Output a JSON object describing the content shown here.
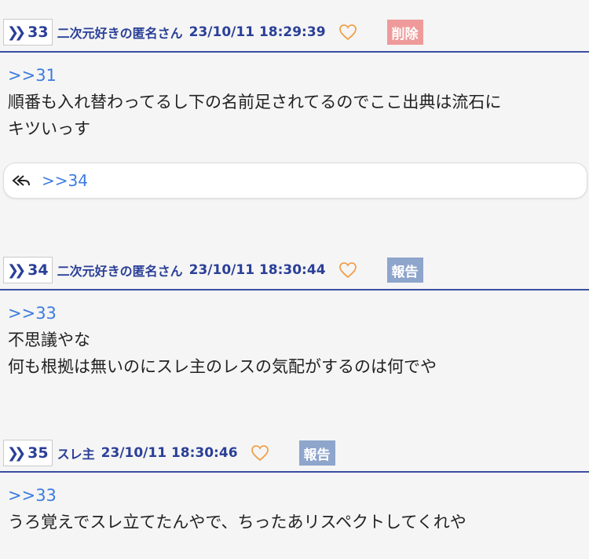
{
  "posts": [
    {
      "number": "33",
      "author": "二次元好きの匿名さん",
      "datetime": "23/10/11 18:29:39",
      "action_label": "削除",
      "anchor": ">>31",
      "lines": [
        "順番も入れ替わってるし下の名前足されてるのでここ出典は流石に",
        "キツいっす"
      ],
      "reply_link": ">>34"
    },
    {
      "number": "34",
      "author": "二次元好きの匿名さん",
      "datetime": "23/10/11 18:30:44",
      "action_label": "報告",
      "anchor": ">>33",
      "lines": [
        "不思議やな",
        "何も根拠は無いのにスレ主のレスの気配がするのは何でや"
      ]
    },
    {
      "number": "35",
      "author": "スレ主",
      "datetime": "23/10/11 18:30:46",
      "action_label": "報告",
      "anchor": ">>33",
      "lines": [
        "うろ覚えでスレ立てたんやで、ちったあリスペクトしてくれや"
      ]
    }
  ],
  "icons": {
    "number_marker": "double-chevron-icon",
    "like": "heart-outline-icon",
    "reply": "reply-all-icon"
  },
  "colors": {
    "header_text": "#2a3f97",
    "anchor_link": "#3d7ce0",
    "delete_button": "#ef9a9a",
    "report_button": "#8ea5cc",
    "heart": "#f0a04b",
    "rule": "#3b4fa1"
  }
}
